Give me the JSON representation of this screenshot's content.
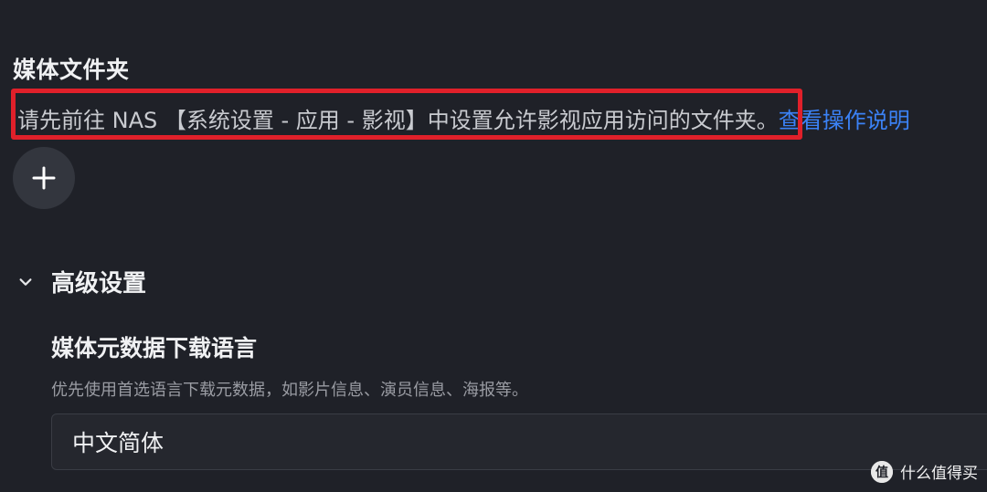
{
  "media_folder": {
    "title": "媒体文件夹",
    "hint_text": "请先前往 NAS 【系统设置 - 应用 - 影视】中设置允许影视应用访问的文件夹。",
    "hint_link": "查看操作说明",
    "add_icon": "plus-icon"
  },
  "advanced": {
    "title": "高级设置",
    "chevron_icon": "chevron-down-icon",
    "metadata_language": {
      "title": "媒体元数据下载语言",
      "description": "优先使用首选语言下载元数据，如影片信息、演员信息、海报等。",
      "selected_value": "中文简体"
    }
  },
  "watermark": {
    "text": "什么值得买",
    "logo_text": "值"
  },
  "colors": {
    "background": "#1f2128",
    "link": "#3b82f6",
    "highlight": "#e0202a"
  }
}
